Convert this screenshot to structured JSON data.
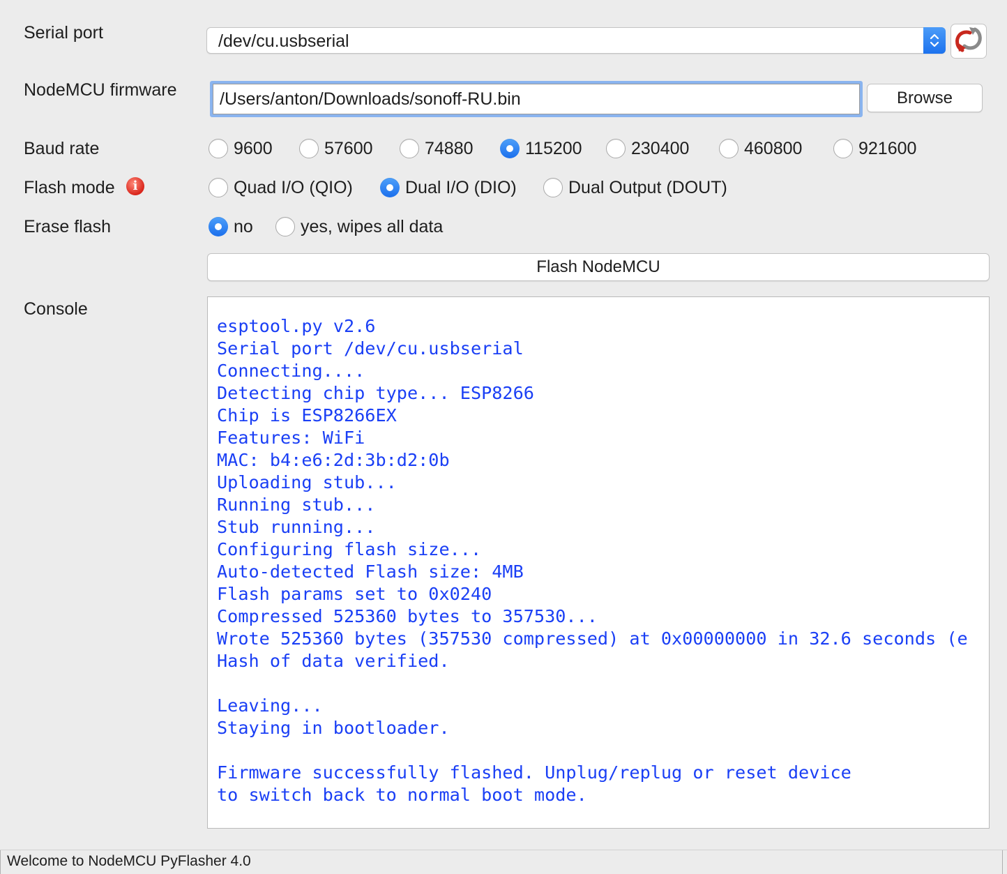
{
  "serial_port": {
    "label": "Serial port",
    "value": "/dev/cu.usbserial"
  },
  "firmware": {
    "label": "NodeMCU firmware",
    "value": "/Users/anton/Downloads/sonoff-RU.bin",
    "browse_label": "Browse"
  },
  "baud_rate": {
    "label": "Baud rate",
    "options": [
      "9600",
      "57600",
      "74880",
      "115200",
      "230400",
      "460800",
      "921600"
    ],
    "selected": "115200"
  },
  "flash_mode": {
    "label": "Flash mode",
    "info_icon": "info-icon",
    "options": [
      "Quad I/O (QIO)",
      "Dual I/O (DIO)",
      "Dual Output (DOUT)"
    ],
    "selected": "Dual I/O (DIO)"
  },
  "erase_flash": {
    "label": "Erase flash",
    "options": [
      "no",
      "yes, wipes all data"
    ],
    "selected": "no"
  },
  "flash_button": {
    "label": "Flash NodeMCU"
  },
  "console": {
    "label": "Console",
    "text_color": "#1a3ff5",
    "lines": [
      "esptool.py v2.6",
      "Serial port /dev/cu.usbserial",
      "Connecting....",
      "Detecting chip type... ESP8266",
      "Chip is ESP8266EX",
      "Features: WiFi",
      "MAC: b4:e6:2d:3b:d2:0b",
      "Uploading stub...",
      "Running stub...",
      "Stub running...",
      "Configuring flash size...",
      "Auto-detected Flash size: 4MB",
      "Flash params set to 0x0240",
      "Compressed 525360 bytes to 357530...",
      "Wrote 525360 bytes (357530 compressed) at 0x00000000 in 32.6 seconds (e",
      "Hash of data verified.",
      "",
      "Leaving...",
      "Staying in bootloader.",
      "",
      "Firmware successfully flashed. Unplug/replug or reset device",
      "to switch back to normal boot mode."
    ]
  },
  "status_bar": {
    "text": "Welcome to NodeMCU PyFlasher 4.0"
  },
  "colors": {
    "accent": "#1b6fec",
    "background": "#ececec",
    "error_icon": "#d9251b"
  }
}
